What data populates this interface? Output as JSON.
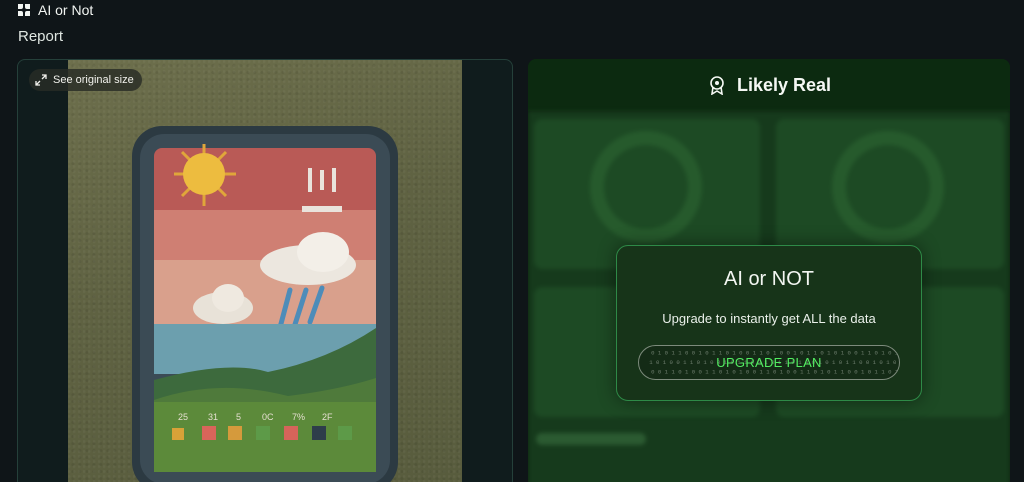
{
  "header": {
    "app_name": "AI or Not",
    "logo_icon": "clover-logo-icon"
  },
  "page": {
    "title": "Report"
  },
  "image_panel": {
    "see_original_label": "See original size",
    "expand_icon": "expand-arrows-icon"
  },
  "result": {
    "verdict": "Likely Real",
    "verdict_icon": "award-badge-icon",
    "accent_color": "#52ec61"
  },
  "upgrade_modal": {
    "title": "AI or NOT",
    "text": "Upgrade to instantly get ALL the data",
    "button_label": "UPGRADE PLAN"
  }
}
